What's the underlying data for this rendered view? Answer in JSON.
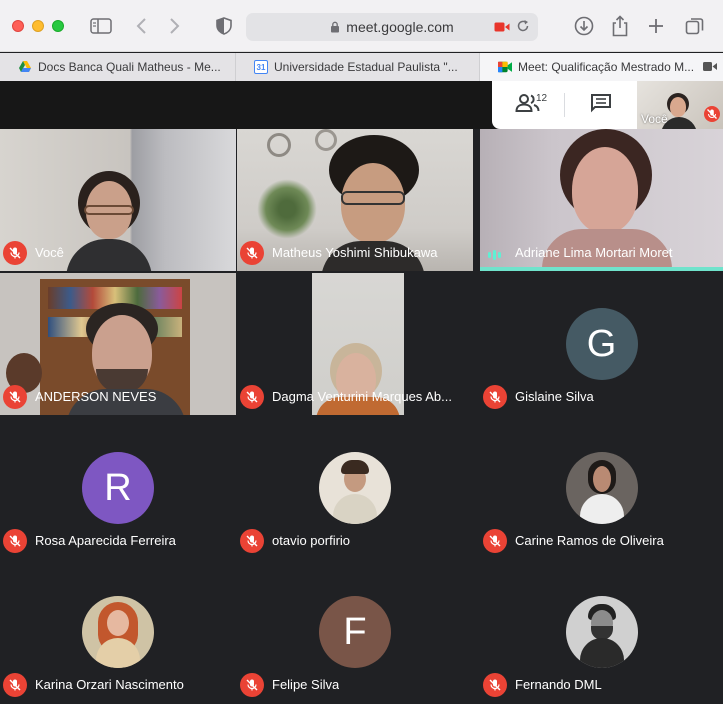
{
  "browser": {
    "url": "meet.google.com",
    "tabs": [
      {
        "title": "Docs Banca Quali Matheus - Me...",
        "favicon": "google-drive-icon",
        "active": false
      },
      {
        "title": "Universidade Estadual Paulista \"...",
        "favicon": "google-calendar-icon",
        "favicon_text": "31",
        "active": false
      },
      {
        "title": "Meet: Qualificação Mestrado M...",
        "favicon": "google-meet-icon",
        "active": true
      }
    ]
  },
  "meet": {
    "people_count": "12",
    "self_preview_label": "Você",
    "colors": {
      "mic_off": "#ea4335",
      "speaking": "#5ef0d4",
      "background": "#202124"
    },
    "participants": [
      {
        "name": "Você",
        "muted": true,
        "type": "video"
      },
      {
        "name": "Matheus Yoshimi Shibukawa",
        "muted": true,
        "type": "video"
      },
      {
        "name": "Adriane Lima Mortari Moret",
        "muted": false,
        "speaking": true,
        "type": "video"
      },
      {
        "name": "ANDERSON NEVES",
        "muted": true,
        "type": "video"
      },
      {
        "name": "Dagma Venturini Marques Ab...",
        "muted": true,
        "type": "video"
      },
      {
        "name": "Gislaine Silva",
        "muted": true,
        "type": "avatar",
        "initial": "G",
        "color": "#455a64"
      },
      {
        "name": "Rosa Aparecida Ferreira",
        "muted": true,
        "type": "avatar",
        "initial": "R",
        "color": "#7e57c2"
      },
      {
        "name": "otavio porfirio",
        "muted": true,
        "type": "photo"
      },
      {
        "name": "Carine Ramos de Oliveira",
        "muted": true,
        "type": "photo"
      },
      {
        "name": "Karina Orzari Nascimento",
        "muted": true,
        "type": "photo"
      },
      {
        "name": "Felipe Silva",
        "muted": true,
        "type": "avatar",
        "initial": "F",
        "color": "#795548"
      },
      {
        "name": "Fernando DML",
        "muted": true,
        "type": "photo"
      }
    ]
  }
}
